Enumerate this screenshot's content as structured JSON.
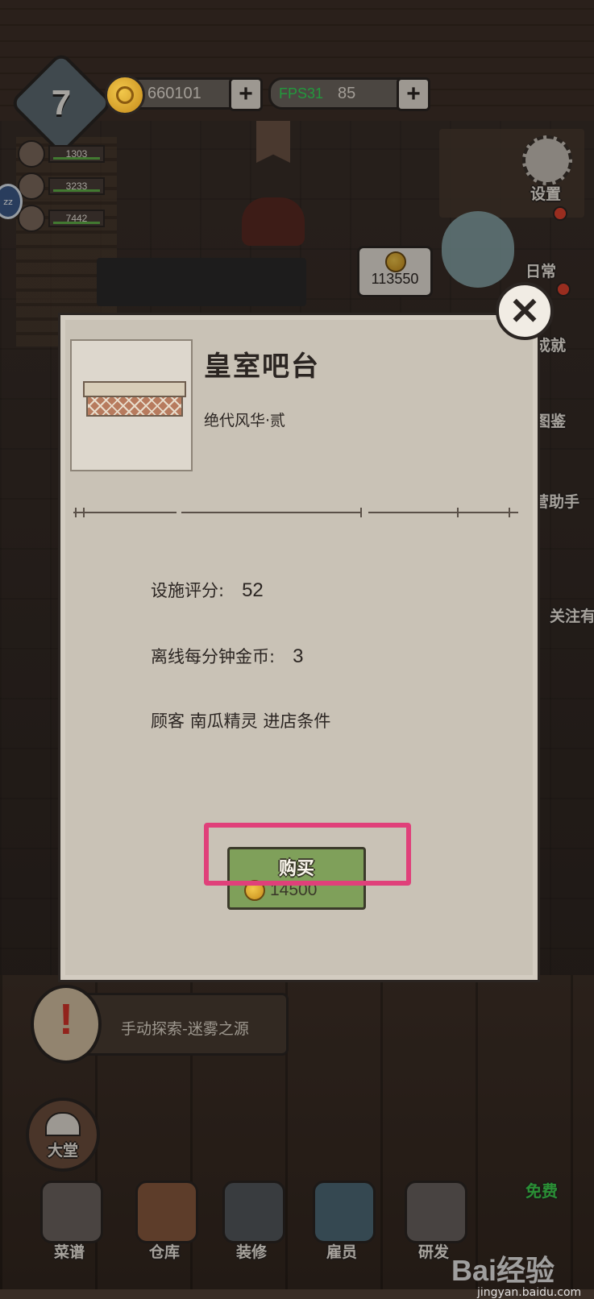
{
  "hud": {
    "level": "7",
    "coins": "660101",
    "fps_label": "FPS31",
    "gems": "85",
    "plus": "+",
    "side_stats": [
      "1303",
      "3233",
      "7442"
    ],
    "zz": "zz"
  },
  "right_menu": {
    "settings": "设置",
    "daily": "日常",
    "achievements": "成就",
    "guide": "图鉴",
    "assistant": "营助手",
    "follow": "关注有"
  },
  "coin_bubble": "113550",
  "dialog": {
    "close": "✕",
    "item_name": "皇室吧台",
    "set_name": "绝代风华·贰",
    "facility_score_label": "设施评分:",
    "facility_score_value": "52",
    "offline_coins_label": "离线每分钟金币:",
    "offline_coins_value": "3",
    "customer_condition": "顾客 南瓜精灵 进店条件",
    "buy_label": "购买",
    "price": "14500",
    "highlight_color": "#e0407a"
  },
  "quest": {
    "text": "手动探索-迷雾之源"
  },
  "bottom_nav": {
    "hall": "大堂",
    "items": [
      "菜谱",
      "仓库",
      "装修",
      "雇员",
      "研发"
    ],
    "free_tag": "免费"
  },
  "watermark": {
    "brand": "Bai经验",
    "site": "jingyan.baidu.com"
  }
}
